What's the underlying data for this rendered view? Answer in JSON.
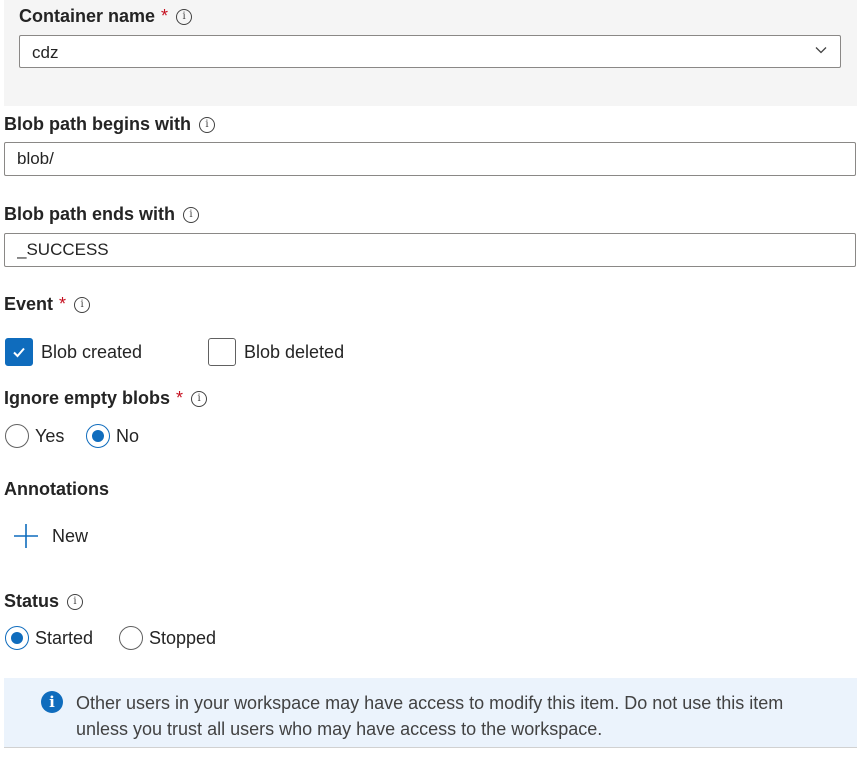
{
  "container": {
    "label": "Container name",
    "required_mark": "*",
    "selected_value": "cdz"
  },
  "blob_begins": {
    "label": "Blob path begins with",
    "value": "blob/"
  },
  "blob_ends": {
    "label": "Blob path ends with",
    "value": "_SUCCESS"
  },
  "event": {
    "label": "Event",
    "required_mark": "*",
    "options": [
      {
        "label": "Blob created",
        "checked": true
      },
      {
        "label": "Blob deleted",
        "checked": false
      }
    ]
  },
  "ignore_empty": {
    "label": "Ignore empty blobs",
    "required_mark": "*",
    "options": [
      {
        "label": "Yes",
        "selected": false
      },
      {
        "label": "No",
        "selected": true
      }
    ]
  },
  "annotations": {
    "label": "Annotations",
    "new_label": "New"
  },
  "status": {
    "label": "Status",
    "options": [
      {
        "label": "Started",
        "selected": true
      },
      {
        "label": "Stopped",
        "selected": false
      }
    ]
  },
  "notice": {
    "text": "Other users in your workspace may have access to modify this item. Do not use this item unless you trust all users who may have access to the workspace."
  },
  "icons": {
    "info": "info-icon",
    "chevron": "chevron-down-icon",
    "check": "checkmark-icon",
    "plus": "plus-icon"
  },
  "colors": {
    "accent": "#0f6cbd",
    "required": "#c50f1f",
    "notice_bg": "#ebf3fc",
    "section_bg": "#f5f5f5"
  }
}
